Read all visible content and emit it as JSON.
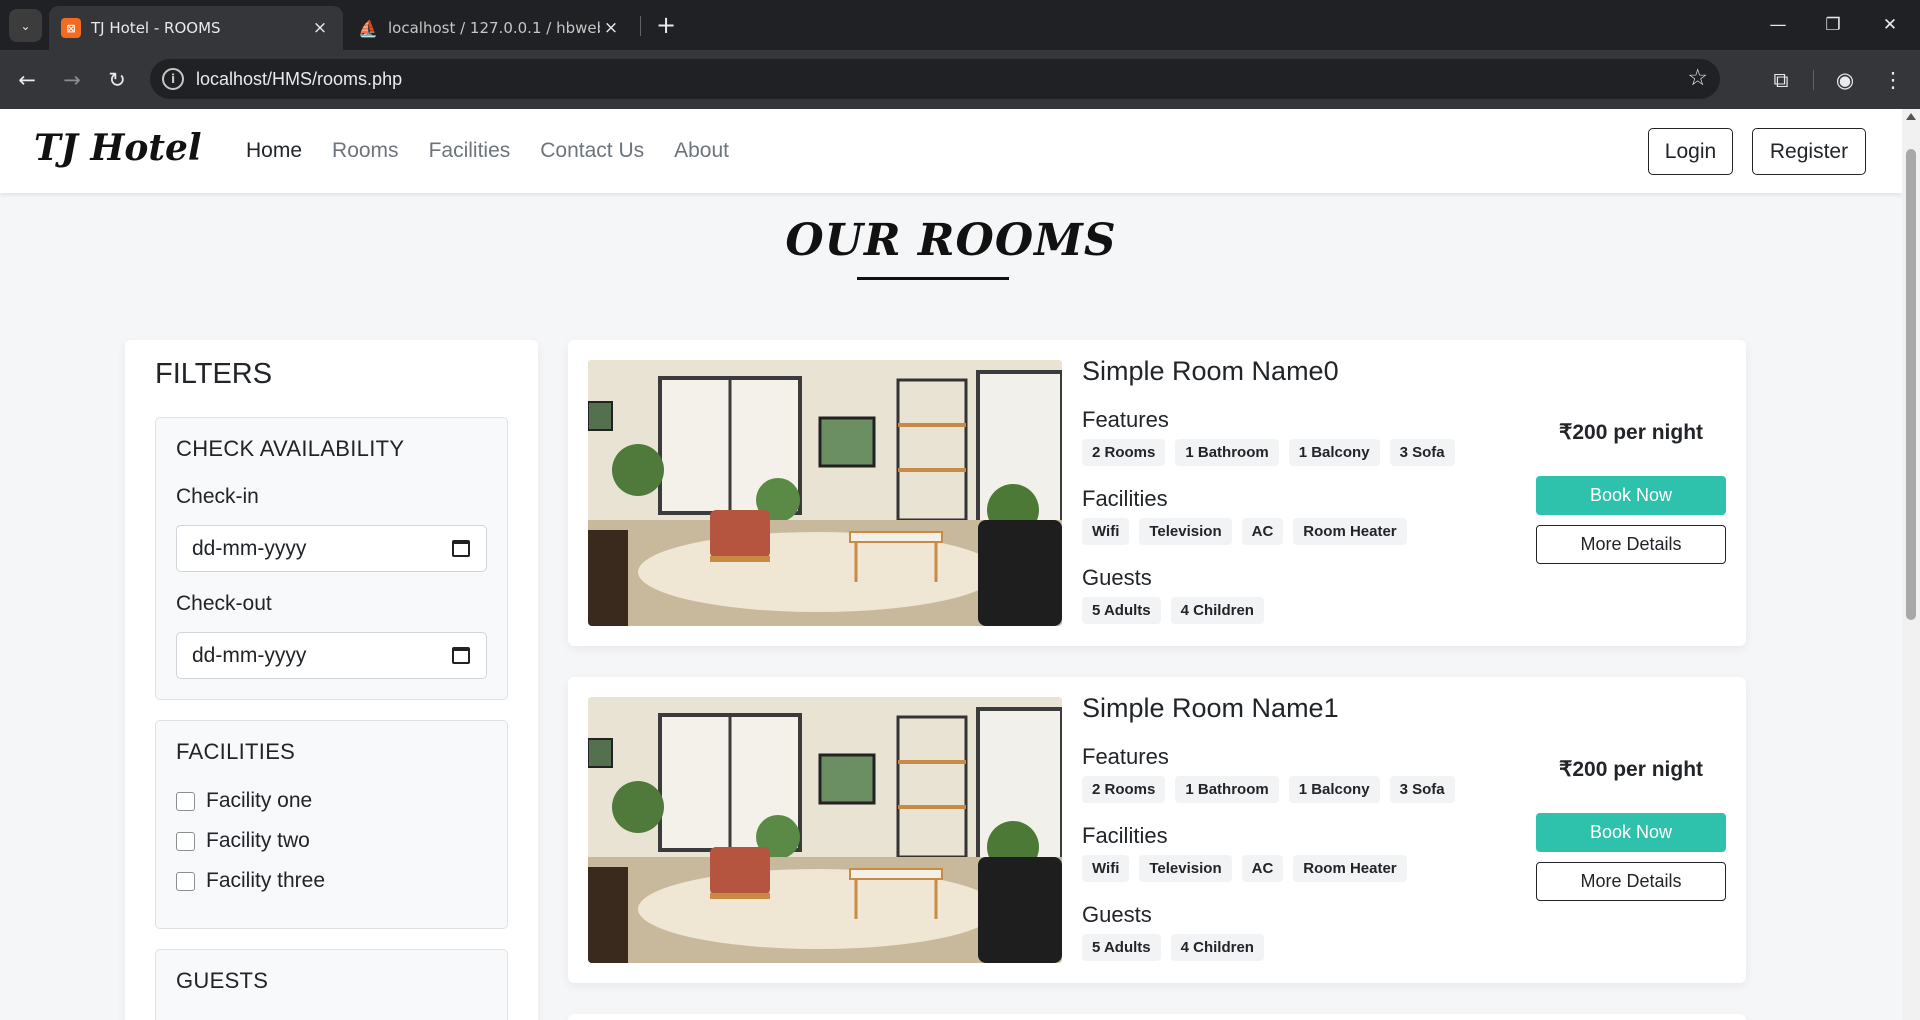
{
  "browser": {
    "tabs": [
      {
        "title": "TJ Hotel - ROOMS",
        "favicon": "xampp-icon"
      },
      {
        "title": "localhost / 127.0.0.1 / hbwebsite",
        "favicon": "phpmyadmin-icon"
      }
    ],
    "url": "localhost/HMS/rooms.php"
  },
  "nav": {
    "brand": "TJ Hotel",
    "links": [
      "Home",
      "Rooms",
      "Facilities",
      "Contact Us",
      "About"
    ],
    "login": "Login",
    "register": "Register"
  },
  "page": {
    "title": "OUR ROOMS"
  },
  "filters": {
    "title": "FILTERS",
    "availability": {
      "heading": "CHECK AVAILABILITY",
      "checkin_label": "Check-in",
      "checkin_value": "dd-mm-yyyy",
      "checkout_label": "Check-out",
      "checkout_value": "dd-mm-yyyy"
    },
    "facilities": {
      "heading": "FACILITIES",
      "options": [
        "Facility one",
        "Facility two",
        "Facility three"
      ]
    },
    "guests": {
      "heading": "GUESTS"
    }
  },
  "rooms": [
    {
      "name": "Simple Room Name0",
      "features_label": "Features",
      "features": [
        "2 Rooms",
        "1 Bathroom",
        "1 Balcony",
        "3 Sofa"
      ],
      "facilities_label": "Facilities",
      "facilities": [
        "Wifi",
        "Television",
        "AC",
        "Room Heater"
      ],
      "guests_label": "Guests",
      "guests": [
        "5 Adults",
        "4 Children"
      ],
      "price": "₹200 per night",
      "book": "Book Now",
      "details": "More Details"
    },
    {
      "name": "Simple Room Name1",
      "features_label": "Features",
      "features": [
        "2 Rooms",
        "1 Bathroom",
        "1 Balcony",
        "3 Sofa"
      ],
      "facilities_label": "Facilities",
      "facilities": [
        "Wifi",
        "Television",
        "AC",
        "Room Heater"
      ],
      "guests_label": "Guests",
      "guests": [
        "5 Adults",
        "4 Children"
      ],
      "price": "₹200 per night",
      "book": "Book Now",
      "details": "More Details"
    }
  ],
  "colors": {
    "accent": "#2ec1ac",
    "chrome_dark": "#202124",
    "page_bg": "#f5f6f8"
  }
}
